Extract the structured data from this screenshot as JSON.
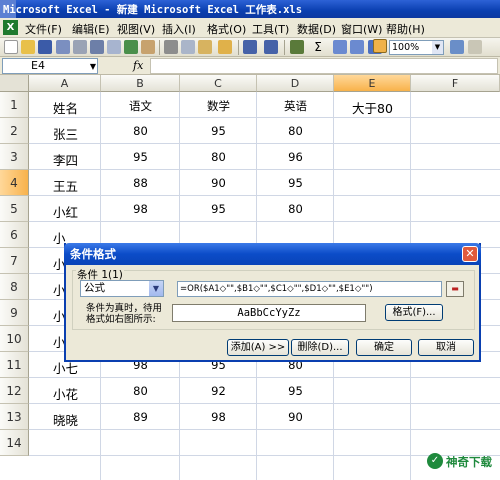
{
  "window": {
    "title": "Microsoft Excel - 新建 Microsoft Excel 工作表.xls"
  },
  "menu": {
    "items": [
      "文件(F)",
      "编辑(E)",
      "视图(V)",
      "插入(I)",
      "格式(O)",
      "工具(T)",
      "数据(D)",
      "窗口(W)",
      "帮助(H)"
    ]
  },
  "toolbar": {
    "zoom": "100%"
  },
  "formula_bar": {
    "name_box": "E4",
    "fx_label": "fx",
    "formula": ""
  },
  "sheet": {
    "columns": [
      "A",
      "B",
      "C",
      "D",
      "E",
      "F"
    ],
    "active_column": "E",
    "active_row": "4",
    "rows": [
      {
        "num": "1",
        "a": "姓名",
        "b": "语文",
        "c": "数学",
        "d": "英语",
        "e": "大于80"
      },
      {
        "num": "2",
        "a": "张三",
        "b": "80",
        "c": "95",
        "d": "80",
        "e": ""
      },
      {
        "num": "3",
        "a": "李四",
        "b": "95",
        "c": "80",
        "d": "96",
        "e": ""
      },
      {
        "num": "4",
        "a": "王五",
        "b": "88",
        "c": "90",
        "d": "95",
        "e": ""
      },
      {
        "num": "5",
        "a": "小红",
        "b": "98",
        "c": "95",
        "d": "80",
        "e": ""
      },
      {
        "num": "6",
        "a": "小",
        "b": "",
        "c": "",
        "d": "",
        "e": ""
      },
      {
        "num": "7",
        "a": "小",
        "b": "",
        "c": "",
        "d": "",
        "e": ""
      },
      {
        "num": "8",
        "a": "小",
        "b": "",
        "c": "",
        "d": "",
        "e": ""
      },
      {
        "num": "9",
        "a": "小",
        "b": "",
        "c": "",
        "d": "",
        "e": ""
      },
      {
        "num": "10",
        "a": "小",
        "b": "",
        "c": "",
        "d": "",
        "e": ""
      },
      {
        "num": "11",
        "a": "小七",
        "b": "98",
        "c": "95",
        "d": "80",
        "e": ""
      },
      {
        "num": "12",
        "a": "小花",
        "b": "80",
        "c": "92",
        "d": "95",
        "e": ""
      },
      {
        "num": "13",
        "a": "晓晓",
        "b": "89",
        "c": "98",
        "d": "90",
        "e": ""
      },
      {
        "num": "14",
        "a": "",
        "b": "",
        "c": "",
        "d": "",
        "e": ""
      }
    ]
  },
  "dialog": {
    "title": "条件格式",
    "close_glyph": "✕",
    "condition_label": "条件 1(1)",
    "condition_type": "公式",
    "formula": "=OR($A1◇\"\",$B1◇\"\",$C1◇\"\",$D1◇\"\",$E1◇\"\")",
    "note": "条件为真时，待用格式如右图所示:",
    "preview_text": "AaBbCcYyZz",
    "format_button": "格式(F)...",
    "add_button": "添加(A) >>",
    "delete_button": "删除(D)...",
    "ok_button": "确定",
    "cancel_button": "取消"
  },
  "watermark": {
    "text": "神奇下载"
  }
}
